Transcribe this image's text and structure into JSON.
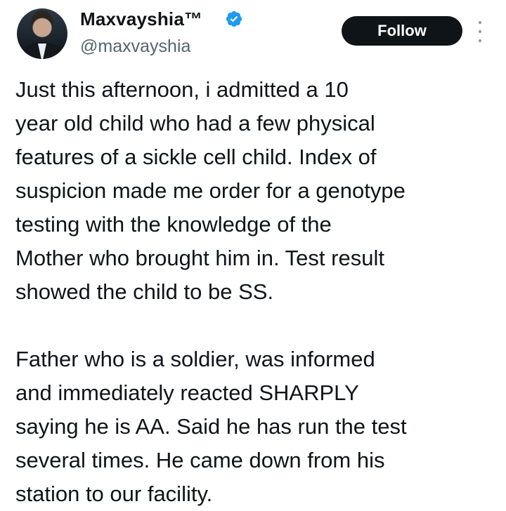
{
  "author": {
    "display_name": "Maxvayshia™",
    "handle": "@maxvayshia",
    "verified_badge_icon": "verified-check-icon",
    "verified_badge_color": "#1d9bf0",
    "avatar_icon": "profile-photo"
  },
  "actions": {
    "follow_label": "Follow",
    "more_icon": "more-vertical-icon"
  },
  "tweet": {
    "paragraph_1_lines": [
      "Just this afternoon, i admitted a 10",
      "year old child who had a few physical",
      "features of a sickle cell child. Index of",
      "suspicion made me order for a genotype",
      "testing with the knowledge of the",
      "Mother who brought him in. Test result",
      "showed the child to be SS."
    ],
    "paragraph_2_lines": [
      "Father who is a soldier, was informed",
      "and immediately reacted SHARPLY",
      "saying he is AA. Said he has run the test",
      "several times. He came down from his",
      "station to our facility."
    ]
  },
  "colors": {
    "text": "#0f1419",
    "secondary_text": "#536471",
    "button_bg": "#0f1419",
    "button_text": "#ffffff"
  }
}
